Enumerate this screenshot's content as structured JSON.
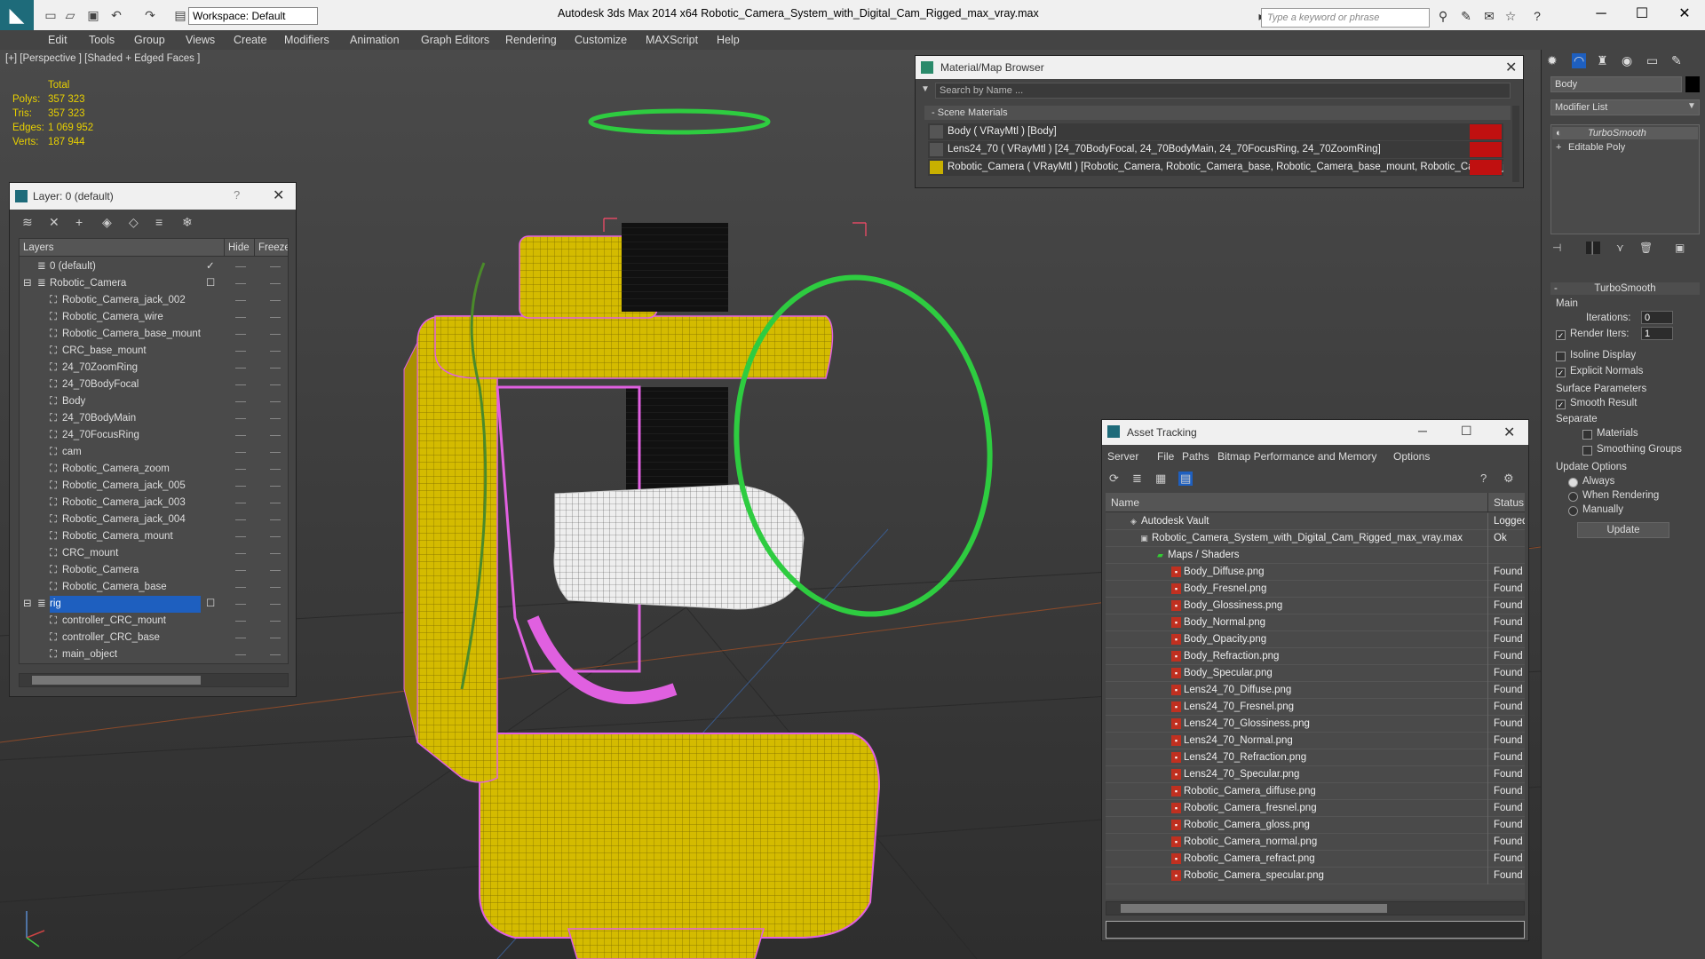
{
  "titlebar": {
    "workspace": "Workspace: Default",
    "title": "Autodesk 3ds Max  2014 x64       Robotic_Camera_System_with_Digital_Cam_Rigged_max_vray.max",
    "search_placeholder": "Type a keyword or phrase"
  },
  "menu": [
    "Edit",
    "Tools",
    "Group",
    "Views",
    "Create",
    "Modifiers",
    "Animation",
    "Graph Editors",
    "Rendering",
    "Customize",
    "MAXScript",
    "Help"
  ],
  "viewport": {
    "label": "[+] [Perspective ] [Shaded + Edged Faces ]",
    "stats": {
      "total_label": "Total",
      "polys_label": "Polys:",
      "polys": "357 323",
      "tris_label": "Tris:",
      "tris": "357 323",
      "edges_label": "Edges:",
      "edges": "1 069 952",
      "verts_label": "Verts:",
      "verts": "187 944"
    }
  },
  "layer_panel": {
    "title": "Layer: 0 (default)",
    "help": "?",
    "columns": {
      "layers": "Layers",
      "hide": "Hide",
      "freeze": "Freeze"
    },
    "rows": [
      "0 (default)",
      "Robotic_Camera",
      "Robotic_Camera_jack_002",
      "Robotic_Camera_wire",
      "Robotic_Camera_base_mount",
      "CRC_base_mount",
      "24_70ZoomRing",
      "24_70BodyFocal",
      "Body",
      "24_70BodyMain",
      "24_70FocusRing",
      "cam",
      "Robotic_Camera_zoom",
      "Robotic_Camera_jack_005",
      "Robotic_Camera_jack_003",
      "Robotic_Camera_jack_004",
      "Robotic_Camera_mount",
      "CRC_mount",
      "Robotic_Camera",
      "Robotic_Camera_base",
      "rig",
      "controller_CRC_mount",
      "controller_CRC_base",
      "main_object"
    ]
  },
  "material_browser": {
    "title": "Material/Map Browser",
    "search_placeholder": "Search by Name ...",
    "section": "Scene Materials",
    "items": [
      "Body  ( VRayMtl )  [Body]",
      "Lens24_70  ( VRayMtl )  [24_70BodyFocal, 24_70BodyMain, 24_70FocusRing, 24_70ZoomRing]",
      "Robotic_Camera  ( VRayMtl )  [Robotic_Camera, Robotic_Camera_base, Robotic_Camera_base_mount, Robotic_Camera_j..."
    ]
  },
  "asset_tracking": {
    "title": "Asset Tracking",
    "menu": [
      "Server",
      "File",
      "Paths",
      "Bitmap Performance and Memory",
      "Options"
    ],
    "columns": {
      "name": "Name",
      "status": "Status"
    },
    "rows": [
      {
        "name": "Autodesk Vault",
        "status": "Logged"
      },
      {
        "name": "Robotic_Camera_System_with_Digital_Cam_Rigged_max_vray.max",
        "status": "Ok"
      },
      {
        "name": "Maps / Shaders",
        "status": ""
      },
      {
        "name": "Body_Diffuse.png",
        "status": "Found"
      },
      {
        "name": "Body_Fresnel.png",
        "status": "Found"
      },
      {
        "name": "Body_Glossiness.png",
        "status": "Found"
      },
      {
        "name": "Body_Normal.png",
        "status": "Found"
      },
      {
        "name": "Body_Opacity.png",
        "status": "Found"
      },
      {
        "name": "Body_Refraction.png",
        "status": "Found"
      },
      {
        "name": "Body_Specular.png",
        "status": "Found"
      },
      {
        "name": "Lens24_70_Diffuse.png",
        "status": "Found"
      },
      {
        "name": "Lens24_70_Fresnel.png",
        "status": "Found"
      },
      {
        "name": "Lens24_70_Glossiness.png",
        "status": "Found"
      },
      {
        "name": "Lens24_70_Normal.png",
        "status": "Found"
      },
      {
        "name": "Lens24_70_Refraction.png",
        "status": "Found"
      },
      {
        "name": "Lens24_70_Specular.png",
        "status": "Found"
      },
      {
        "name": "Robotic_Camera_diffuse.png",
        "status": "Found"
      },
      {
        "name": "Robotic_Camera_fresnel.png",
        "status": "Found"
      },
      {
        "name": "Robotic_Camera_gloss.png",
        "status": "Found"
      },
      {
        "name": "Robotic_Camera_normal.png",
        "status": "Found"
      },
      {
        "name": "Robotic_Camera_refract.png",
        "status": "Found"
      },
      {
        "name": "Robotic_Camera_specular.png",
        "status": "Found"
      }
    ]
  },
  "command_panel": {
    "object_name": "Body",
    "modifier_list": "Modifier List",
    "stack": [
      "TurboSmooth",
      "Editable Poly"
    ],
    "rollout_title": "TurboSmooth",
    "main_label": "Main",
    "iterations_label": "Iterations:",
    "iterations": "0",
    "render_iters_label": "Render Iters:",
    "render_iters": "1",
    "isoline_label": "Isoline Display",
    "explicit_normals_label": "Explicit Normals",
    "surface_params_label": "Surface Parameters",
    "smooth_result_label": "Smooth Result",
    "separate_label": "Separate",
    "materials_label": "Materials",
    "smoothing_groups_label": "Smoothing Groups",
    "update_options_label": "Update Options",
    "always_label": "Always",
    "when_rendering_label": "When Rendering",
    "manually_label": "Manually",
    "update_button": "Update"
  },
  "colors": {
    "mesh_yellow": "#e0c800",
    "wire_magenta": "#e060e0",
    "controller_green": "#2ecc40",
    "selection_blue": "#1e5fbf"
  }
}
